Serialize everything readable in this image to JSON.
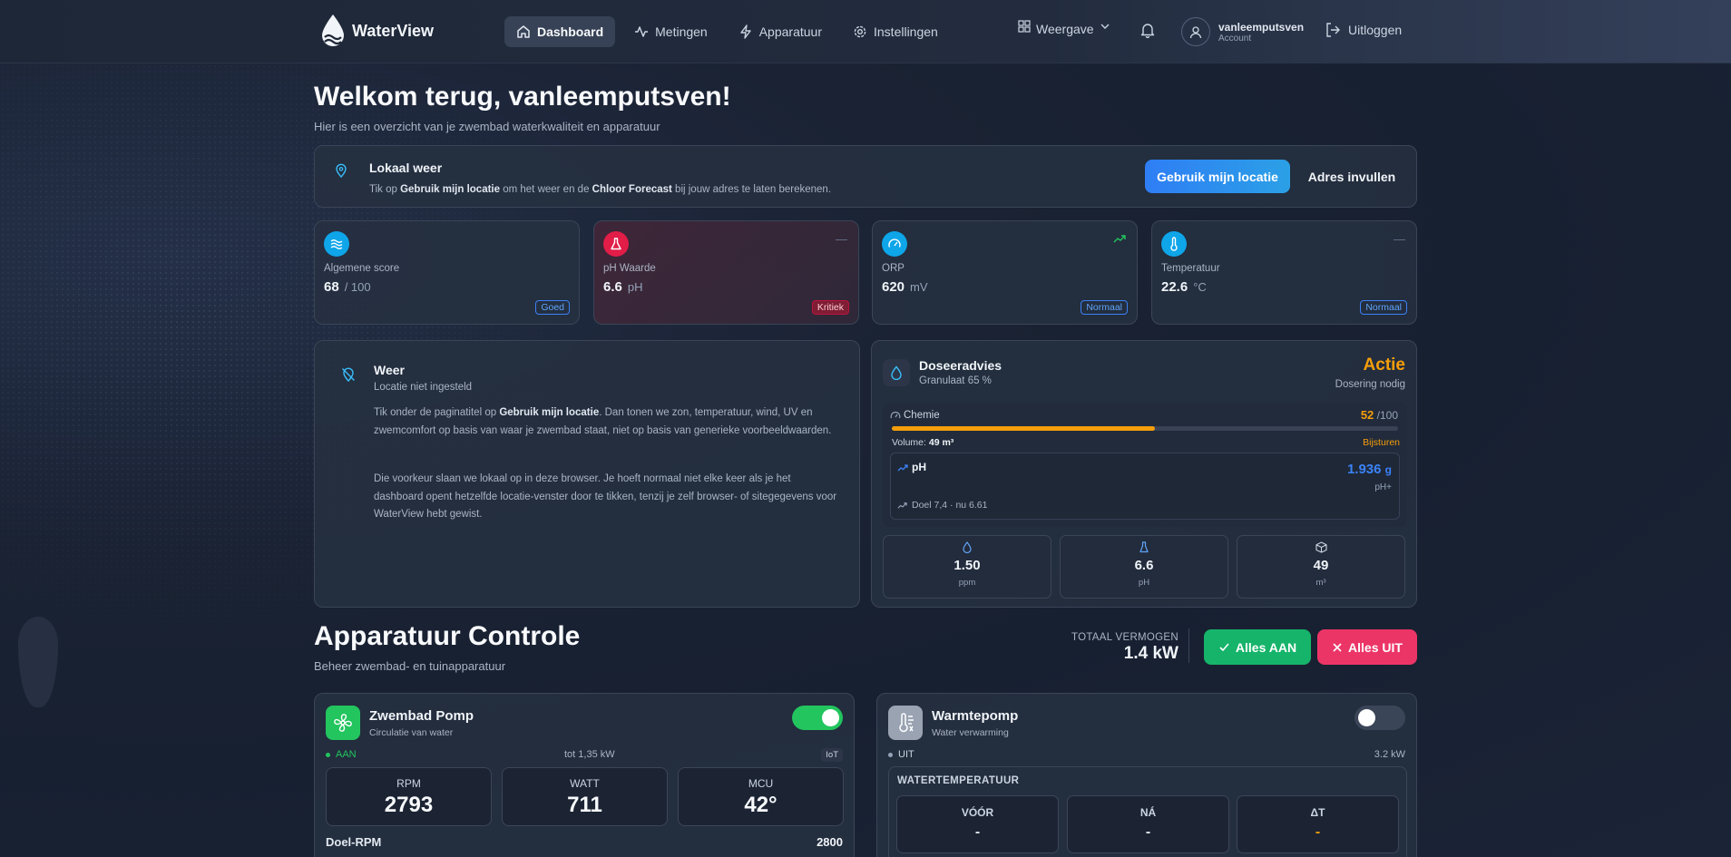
{
  "app": {
    "name": "WaterView"
  },
  "nav": {
    "items": [
      {
        "label": "Dashboard",
        "icon": "home-icon"
      },
      {
        "label": "Metingen",
        "icon": "activity-icon"
      },
      {
        "label": "Apparatuur",
        "icon": "bolt-icon"
      },
      {
        "label": "Instellingen",
        "icon": "gear-icon"
      }
    ],
    "view_label": "Weergave",
    "account_name": "vanleemputsven",
    "account_sub": "Account",
    "logout_label": "Uitloggen"
  },
  "welcome": {
    "title": "Welkom terug, vanleemputsven!",
    "subtitle": "Hier is een overzicht van je zwembad waterkwaliteit en apparatuur"
  },
  "location": {
    "title": "Lokaal weer",
    "desc_1": "Tik op ",
    "desc_b1": "Gebruik mijn locatie",
    "desc_2": " om het weer en de ",
    "desc_b2": "Chloor Forecast",
    "desc_3": " bij jouw adres te laten berekenen.",
    "use_location_button": "Gebruik mijn locatie",
    "address_button": "Adres invullen"
  },
  "stats": [
    {
      "label": "Algemene score",
      "value": "68",
      "unit": "/ 100",
      "badge": "Goed",
      "trend": "",
      "color": "#0ea5e9"
    },
    {
      "label": "pH Waarde",
      "value": "6.6",
      "unit": "pH",
      "badge": "Kritiek",
      "trend": "—",
      "color": "#e11d48"
    },
    {
      "label": "ORP",
      "value": "620",
      "unit": "mV",
      "badge": "Normaal",
      "trend": "",
      "color": "#0ea5e9"
    },
    {
      "label": "Temperatuur",
      "value": "22.6",
      "unit": "°C",
      "badge": "Normaal",
      "trend": "—",
      "color": "#0ea5e9"
    }
  ],
  "weather": {
    "title": "Weer",
    "subtitle": "Locatie niet ingesteld",
    "p1_a": "Tik onder de paginatitel op ",
    "p1_b": "Gebruik mijn locatie",
    "p1_c": ". Dan tonen we zon, temperatuur, wind, UV en zwemcomfort op basis van waar je zwembad staat, niet op basis van generieke voorbeeldwaarden.",
    "p2": "Die voorkeur slaan we lokaal op in deze browser. Je hoeft normaal niet elke keer als je het dashboard opent hetzelfde locatie-venster door te tikken, tenzij je zelf browser- of sitegegevens voor WaterView hebt gewist."
  },
  "dosing": {
    "title": "Doseeradvies",
    "subtitle": "Granulaat 65 %",
    "action": "Actie",
    "need": "Dosering nodig",
    "chem_label": "Chemie",
    "chem_score": "52",
    "chem_max": "/100",
    "chem_fraction": 0.52,
    "volume_label": "Volume:",
    "volume_value": "49 m³",
    "adjust_label": "Bijsturen",
    "ph_label": "pH",
    "ph_dose": "1.936",
    "ph_dose_unit": "g",
    "ph_product": "pH+",
    "ph_target": "Doel 7,4 · nu 6.61",
    "mini": [
      {
        "value": "1.50",
        "unit": "ppm",
        "icon": "drop-icon"
      },
      {
        "value": "6.6",
        "unit": "pH",
        "icon": "flask-icon"
      },
      {
        "value": "49",
        "unit": "m³",
        "icon": "cube-icon"
      }
    ]
  },
  "equipment": {
    "title": "Apparatuur Controle",
    "subtitle": "Beheer zwembad- en tuinapparatuur",
    "total_label": "TOTAAL VERMOGEN",
    "total_value": "1.4 kW",
    "all_on": "Alles AAN",
    "all_off": "Alles UIT",
    "devices": [
      {
        "name": "Zwembad Pomp",
        "desc": "Circulatie van water",
        "on": true,
        "state": "AAN",
        "power_note": "tot 1,35 kW",
        "tag": "IoT",
        "metrics": [
          {
            "label": "RPM",
            "value": "2793"
          },
          {
            "label": "WATT",
            "value": "711"
          },
          {
            "label": "MCU",
            "value": "42°"
          }
        ],
        "target_label": "Doel-RPM",
        "target_value": "2800"
      },
      {
        "name": "Warmtepomp",
        "desc": "Water verwarming",
        "on": false,
        "state": "UIT",
        "power": "3.2 kW",
        "water_temp_title": "WATERTEMPERATUUR",
        "temps": [
          {
            "label": "VÓÓR",
            "value": "-"
          },
          {
            "label": "NÁ",
            "value": "-"
          },
          {
            "label": "ΔT",
            "value": "-"
          }
        ]
      }
    ]
  }
}
